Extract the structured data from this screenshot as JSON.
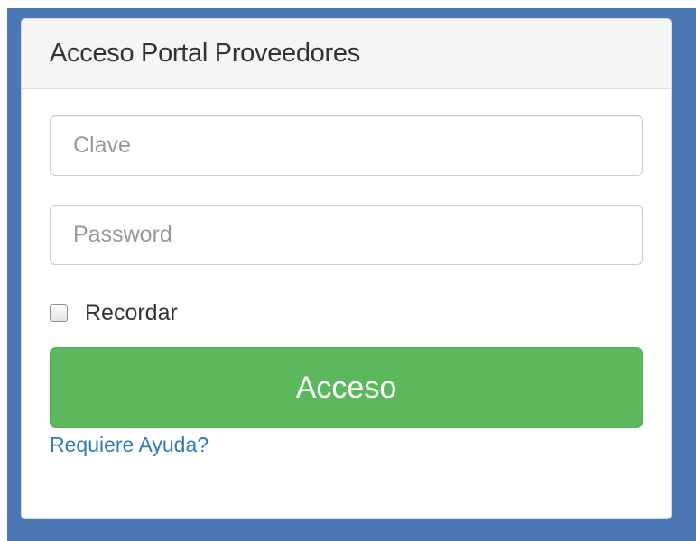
{
  "panel": {
    "title": "Acceso Portal Proveedores"
  },
  "form": {
    "username_placeholder": "Clave",
    "username_value": "",
    "password_placeholder": "Password",
    "password_value": "",
    "remember_label": "Recordar",
    "remember_checked": false,
    "submit_label": "Acceso",
    "help_link": "Requiere Ayuda?"
  },
  "colors": {
    "background_frame": "#4b77b4",
    "button": "#5cb85c",
    "link": "#337ab7"
  }
}
